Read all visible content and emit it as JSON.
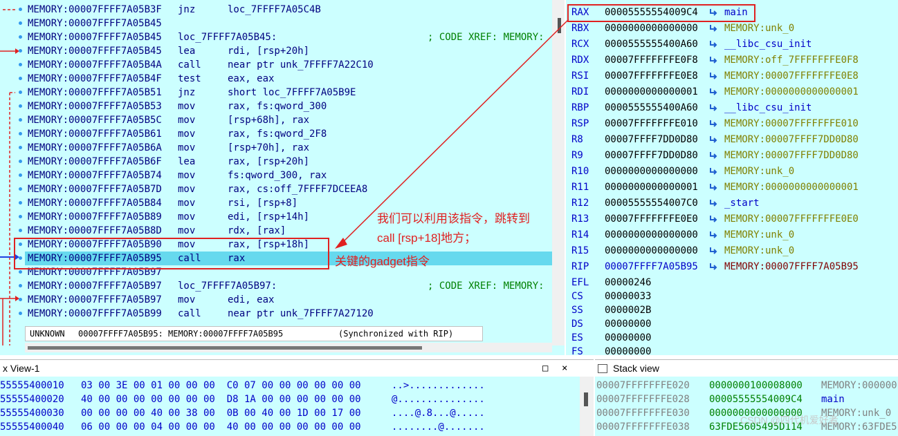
{
  "disasm": {
    "lines": [
      {
        "addr": "MEMORY:00007FFFF7A05B3F",
        "mn": "jnz",
        "op": "loc_7FFFF7A05C4B",
        "cmt": ""
      },
      {
        "addr": "MEMORY:00007FFFF7A05B45",
        "mn": "",
        "op": "",
        "cmt": ""
      },
      {
        "addr": "MEMORY:00007FFFF7A05B45",
        "mn": "loc_7FFFF7A05B45:",
        "op": "",
        "cmt": "; CODE XREF: MEMORY:"
      },
      {
        "addr": "MEMORY:00007FFFF7A05B45",
        "mn": "lea",
        "op": "rdi, [rsp+20h]",
        "cmt": ""
      },
      {
        "addr": "MEMORY:00007FFFF7A05B4A",
        "mn": "call",
        "op": "near ptr unk_7FFFF7A22C10",
        "cmt": ""
      },
      {
        "addr": "MEMORY:00007FFFF7A05B4F",
        "mn": "test",
        "op": "eax, eax",
        "cmt": ""
      },
      {
        "addr": "MEMORY:00007FFFF7A05B51",
        "mn": "jnz",
        "op": "short loc_7FFFF7A05B9E",
        "cmt": ""
      },
      {
        "addr": "MEMORY:00007FFFF7A05B53",
        "mn": "mov",
        "op": "rax, fs:qword_300",
        "cmt": ""
      },
      {
        "addr": "MEMORY:00007FFFF7A05B5C",
        "mn": "mov",
        "op": "[rsp+68h], rax",
        "cmt": ""
      },
      {
        "addr": "MEMORY:00007FFFF7A05B61",
        "mn": "mov",
        "op": "rax, fs:qword_2F8",
        "cmt": ""
      },
      {
        "addr": "MEMORY:00007FFFF7A05B6A",
        "mn": "mov",
        "op": "[rsp+70h], rax",
        "cmt": ""
      },
      {
        "addr": "MEMORY:00007FFFF7A05B6F",
        "mn": "lea",
        "op": "rax, [rsp+20h]",
        "cmt": ""
      },
      {
        "addr": "MEMORY:00007FFFF7A05B74",
        "mn": "mov",
        "op": "fs:qword_300, rax",
        "cmt": ""
      },
      {
        "addr": "MEMORY:00007FFFF7A05B7D",
        "mn": "mov",
        "op": "rax, cs:off_7FFFF7DCEEA8",
        "cmt": ""
      },
      {
        "addr": "MEMORY:00007FFFF7A05B84",
        "mn": "mov",
        "op": "rsi, [rsp+8]",
        "cmt": ""
      },
      {
        "addr": "MEMORY:00007FFFF7A05B89",
        "mn": "mov",
        "op": "edi, [rsp+14h]",
        "cmt": ""
      },
      {
        "addr": "MEMORY:00007FFFF7A05B8D",
        "mn": "mov",
        "op": "rdx, [rax]",
        "cmt": ""
      },
      {
        "addr": "MEMORY:00007FFFF7A05B90",
        "mn": "mov",
        "op": "rax, [rsp+18h]",
        "cmt": ""
      },
      {
        "addr": "MEMORY:00007FFFF7A05B95",
        "mn": "call",
        "op": "rax",
        "cmt": ""
      },
      {
        "addr": "MEMORY:00007FFFF7A05B97",
        "mn": "",
        "op": "",
        "cmt": ""
      },
      {
        "addr": "MEMORY:00007FFFF7A05B97",
        "mn": "loc_7FFFF7A05B97:",
        "op": "",
        "cmt": "; CODE XREF: MEMORY:"
      },
      {
        "addr": "MEMORY:00007FFFF7A05B97",
        "mn": "mov",
        "op": "edi, eax",
        "cmt": ""
      },
      {
        "addr": "MEMORY:00007FFFF7A05B99",
        "mn": "call",
        "op": "near ptr unk_7FFFF7A27120",
        "cmt": ""
      }
    ],
    "status": {
      "seg1": "UNKNOWN",
      "seg2": "00007FFFF7A05B95: MEMORY:00007FFFF7A05B95",
      "seg3": "(Synchronized with RIP)"
    }
  },
  "registers": [
    {
      "name": "RAX",
      "value": "00005555554009C4",
      "ref": "main",
      "kind": "code"
    },
    {
      "name": "RBX",
      "value": "0000000000000000",
      "ref": "MEMORY:unk_0",
      "kind": "data"
    },
    {
      "name": "RCX",
      "value": "0000555555400A60",
      "ref": "__libc_csu_init",
      "kind": "code"
    },
    {
      "name": "RDX",
      "value": "00007FFFFFFFE0F8",
      "ref": "MEMORY:off_7FFFFFFFE0F8",
      "kind": "data"
    },
    {
      "name": "RSI",
      "value": "00007FFFFFFFE0E8",
      "ref": "MEMORY:00007FFFFFFFE0E8",
      "kind": "data"
    },
    {
      "name": "RDI",
      "value": "0000000000000001",
      "ref": "MEMORY:0000000000000001",
      "kind": "data"
    },
    {
      "name": "RBP",
      "value": "0000555555400A60",
      "ref": "__libc_csu_init",
      "kind": "code"
    },
    {
      "name": "RSP",
      "value": "00007FFFFFFFE010",
      "ref": "MEMORY:00007FFFFFFFE010",
      "kind": "data"
    },
    {
      "name": "R8",
      "value": "00007FFFF7DD0D80",
      "ref": "MEMORY:00007FFFF7DD0D80",
      "kind": "data"
    },
    {
      "name": "R9",
      "value": "00007FFFF7DD0D80",
      "ref": "MEMORY:00007FFFF7DD0D80",
      "kind": "data"
    },
    {
      "name": "R10",
      "value": "0000000000000000",
      "ref": "MEMORY:unk_0",
      "kind": "data"
    },
    {
      "name": "R11",
      "value": "0000000000000001",
      "ref": "MEMORY:0000000000000001",
      "kind": "data"
    },
    {
      "name": "R12",
      "value": "00005555554007C0",
      "ref": "_start",
      "kind": "code"
    },
    {
      "name": "R13",
      "value": "00007FFFFFFFE0E0",
      "ref": "MEMORY:00007FFFFFFFE0E0",
      "kind": "data"
    },
    {
      "name": "R14",
      "value": "0000000000000000",
      "ref": "MEMORY:unk_0",
      "kind": "data"
    },
    {
      "name": "R15",
      "value": "0000000000000000",
      "ref": "MEMORY:unk_0",
      "kind": "data"
    },
    {
      "name": "RIP",
      "value": "00007FFFF7A05B95",
      "ref": "MEMORY:00007FFFF7A05B95",
      "kind": "rip"
    },
    {
      "name": "EFL",
      "value": "00000246",
      "ref": "",
      "kind": "none"
    },
    {
      "name": "CS",
      "value": "00000033",
      "ref": "",
      "kind": "none"
    },
    {
      "name": "SS",
      "value": "0000002B",
      "ref": "",
      "kind": "none"
    },
    {
      "name": "DS",
      "value": "00000000",
      "ref": "",
      "kind": "none"
    },
    {
      "name": "ES",
      "value": "00000000",
      "ref": "",
      "kind": "none"
    },
    {
      "name": "FS",
      "value": "00000000",
      "ref": "",
      "kind": "none"
    }
  ],
  "hex": {
    "title": "x View-1",
    "rows": [
      {
        "addr": "55555400010",
        "bytes": "03 00 3E 00 01 00 00 00  C0 07 00 00 00 00 00 00",
        "ascii": "..>............."
      },
      {
        "addr": "55555400020",
        "bytes": "40 00 00 00 00 00 00 00  D8 1A 00 00 00 00 00 00",
        "ascii": "@..............."
      },
      {
        "addr": "55555400030",
        "bytes": "00 00 00 00 40 00 38 00  0B 00 40 00 1D 00 17 00",
        "ascii": "....@.8...@....."
      },
      {
        "addr": "55555400040",
        "bytes": "06 00 00 00 04 00 00 00  40 00 00 00 00 00 00 00",
        "ascii": "........@......."
      }
    ]
  },
  "stack": {
    "title": "Stack view",
    "rows": [
      {
        "addr": "00007FFFFFFFE020",
        "val": "0000000100008000",
        "ref": "MEMORY:000000",
        "kind": "data"
      },
      {
        "addr": "00007FFFFFFFE028",
        "val": "00005555554009C4",
        "ref": "main",
        "kind": "code"
      },
      {
        "addr": "00007FFFFFFFE030",
        "val": "0000000000000000",
        "ref": "MEMORY:unk_0",
        "kind": "data"
      },
      {
        "addr": "00007FFFFFFFE038",
        "val": "63FDE5605495D114",
        "ref": "MEMORY:63FDE5",
        "kind": "data"
      }
    ]
  },
  "annotations": {
    "line1": "我们可以利用该指令，跳转到",
    "line2": "call [rsp+18]地方；",
    "line3": "关键的gadget指令"
  },
  "watermark": "CSDN @四代机爱好者",
  "colors": {
    "accent_red": "#e02020",
    "pane_bg": "#ccffff",
    "highlight": "#66d9ee"
  }
}
